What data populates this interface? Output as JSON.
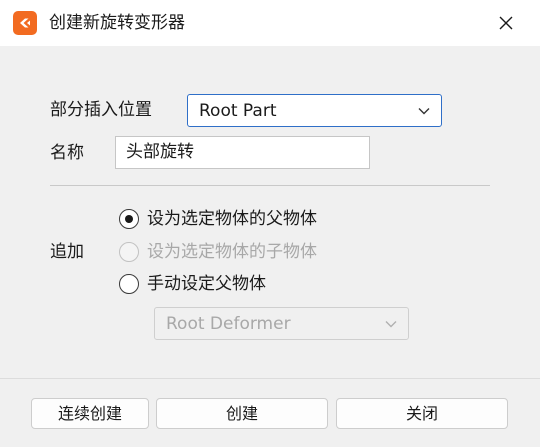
{
  "window": {
    "title": "创建新旋转变形器"
  },
  "form": {
    "part_label": "部分插入位置",
    "part_value": "Root Part",
    "name_label": "名称",
    "name_value": "头部旋转",
    "append_label": "追加",
    "radio_options": [
      {
        "label": "设为选定物体的父物体",
        "checked": true,
        "enabled": true
      },
      {
        "label": "设为选定物体的子物体",
        "checked": false,
        "enabled": false
      },
      {
        "label": "手动设定父物体",
        "checked": false,
        "enabled": true
      }
    ],
    "parent_deformer_value": "Root Deformer"
  },
  "buttons": {
    "continue_create": "连续创建",
    "create": "创建",
    "close": "关闭"
  },
  "colors": {
    "app_icon": "#f26b21",
    "focus_border": "#2f6fc8",
    "background": "#f0f0f0"
  }
}
